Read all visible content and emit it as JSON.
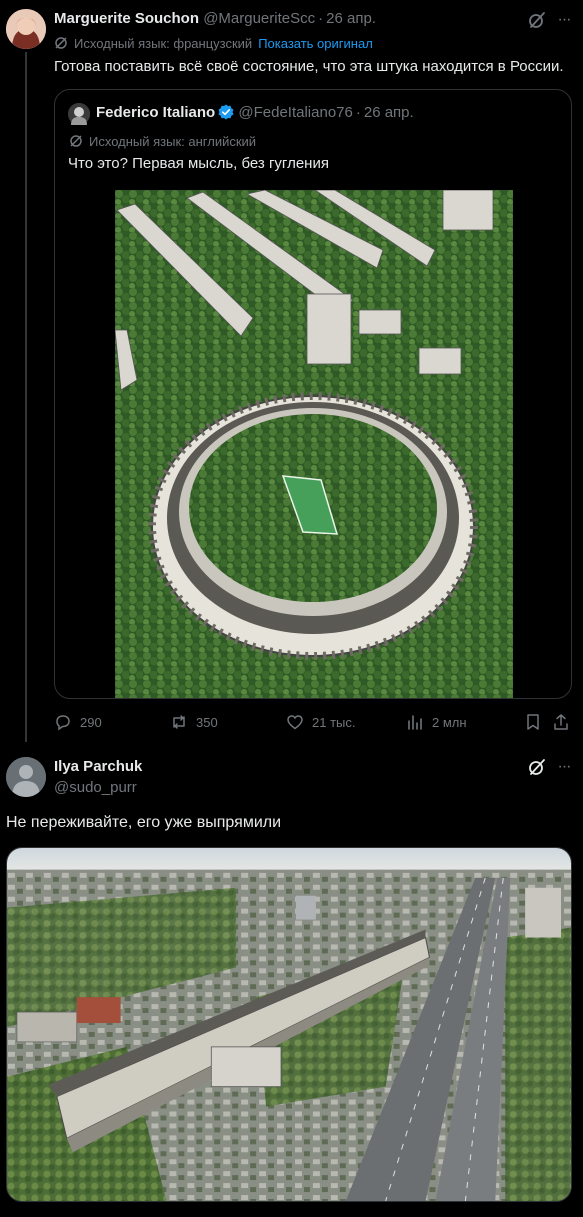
{
  "post1": {
    "author_name": "Marguerite Souchon",
    "author_handle": "@MargueriteScc",
    "date": "26 апр.",
    "separator": "·",
    "translate_label": "Исходный язык: французский",
    "show_original": "Показать оригинал",
    "text": "Готова поставить всё своё состояние, что эта штука находится в России.",
    "quote": {
      "author_name": "Federico Italiano",
      "author_handle": "@FedeItaliano76",
      "date": "26 апр.",
      "translate_label": "Исходный язык: английский",
      "text": "Что это? Первая мысль, без гугления"
    },
    "actions": {
      "replies": "290",
      "reposts": "350",
      "likes": "21 тыс.",
      "views": "2 млн"
    }
  },
  "post2": {
    "author_name": "Ilya Parchuk",
    "author_handle": "@sudo_purr",
    "text": "Не переживайте, его уже выпрямили"
  },
  "colors": {
    "background": "#000000",
    "text": "#e7e9ea",
    "muted": "#71767b",
    "accent": "#1d9bf0",
    "border": "#2f3336"
  },
  "icons": [
    "grok-icon",
    "more-icon",
    "translate-icon",
    "verified-badge-icon",
    "reply-icon",
    "repost-icon",
    "like-icon",
    "views-icon",
    "bookmark-icon",
    "share-icon"
  ]
}
